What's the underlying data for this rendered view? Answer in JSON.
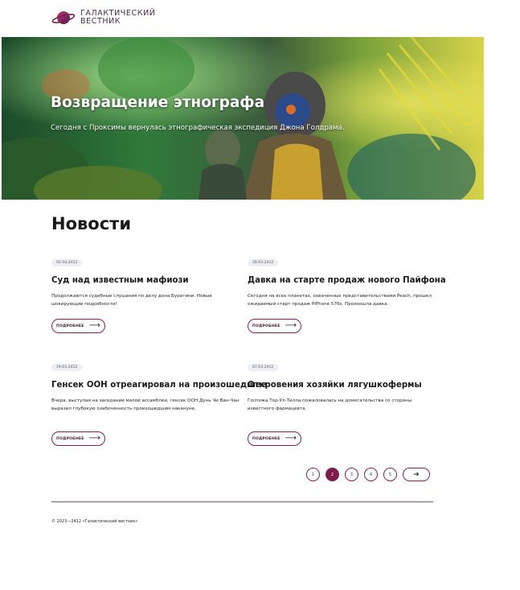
{
  "site": {
    "name_line1": "ГАЛАКТИЧЕСКИЙ",
    "name_line2": "ВЕСТНИК",
    "logo_icon": "planet-ring-icon"
  },
  "hero": {
    "title": "Возвращение этнографа",
    "subtitle": "Сегодня с Проксимы вернулась этнографическая экспедиция Джона Голдрама."
  },
  "news": {
    "section_title": "Новости",
    "more_label": "ПОДРОБНЕЕ",
    "items": [
      {
        "date": "02.04.2412",
        "title": "Суд над известным мафиози",
        "text": "Продолжаются судебные слушания по делу дона Буратини. Новые шокирующие подробности!"
      },
      {
        "date": "28.03.2412",
        "title": "Давка на старте продаж нового Пайфона",
        "text": "Сегодня на всех планетах, охваченных представительствами Peach, прошел ожидаемый старт продаж PiPhone 576s. Произошла давка."
      },
      {
        "date": "19.03.2412",
        "title": "Генсек ООН отреагировал на произошедшее",
        "text": "Вчера, выступая на заседании малой ассамблеи, генсек ООН Дунь Чи Ван-Чан выразил глубокую озабоченность произошедшим накануне."
      },
      {
        "date": "07.03.2412",
        "title": "Откровения хозяйки лягушкофермы",
        "text": "Госпожа Тор-Ул-Тилла пожаловалась на домогательства со стороны известного фармацевта."
      }
    ]
  },
  "pagination": {
    "pages": [
      "1",
      "2",
      "3",
      "4",
      "5"
    ],
    "active": "2",
    "next_icon": "arrow-right-icon"
  },
  "footer": {
    "copyright": "© 2023—2412 «Галактический вестник»"
  },
  "colors": {
    "accent": "#7d1c4a",
    "brand_text": "#4b2a54"
  }
}
